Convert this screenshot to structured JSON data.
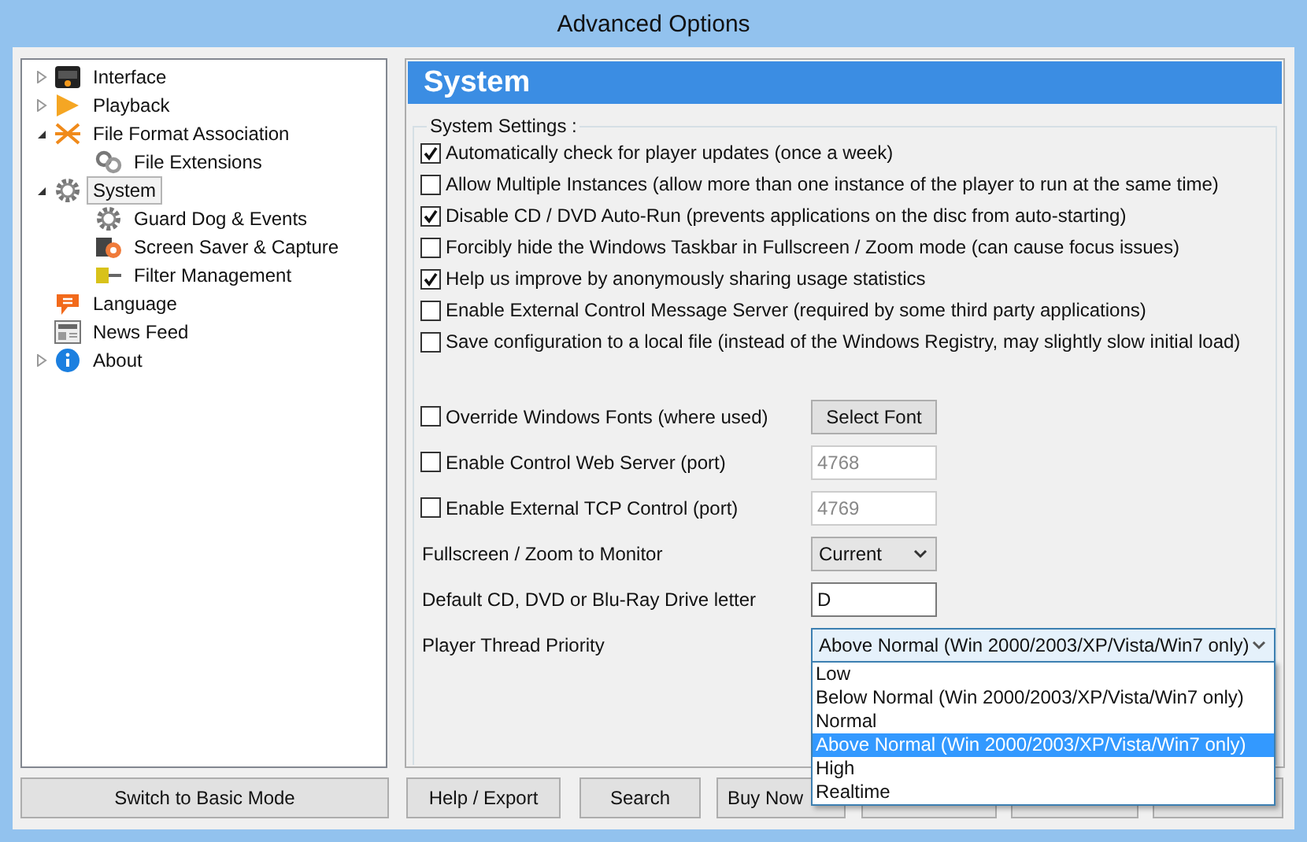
{
  "window": {
    "title": "Advanced Options"
  },
  "tree": [
    {
      "label": "Interface",
      "expanded": false,
      "selected": false
    },
    {
      "label": "Playback",
      "expanded": false,
      "selected": false
    },
    {
      "label": "File Format Association",
      "expanded": true,
      "selected": false,
      "children": [
        {
          "label": "File Extensions",
          "selected": false
        }
      ]
    },
    {
      "label": "System",
      "expanded": true,
      "selected": true,
      "children": [
        {
          "label": "Guard Dog & Events",
          "selected": false
        },
        {
          "label": "Screen Saver & Capture",
          "selected": false
        },
        {
          "label": "Filter Management",
          "selected": false
        }
      ]
    },
    {
      "label": "Language",
      "selected": false
    },
    {
      "label": "News Feed",
      "selected": false
    },
    {
      "label": "About",
      "expanded": false,
      "selected": false
    }
  ],
  "panel": {
    "title": "System",
    "legend": "System Settings :",
    "checkboxes": [
      {
        "label": "Automatically check for player updates (once a week)",
        "checked": true
      },
      {
        "label": "Allow Multiple Instances (allow more than one instance of the player to run at the same time)",
        "checked": false
      },
      {
        "label": "Disable CD / DVD Auto-Run (prevents applications on the disc from auto-starting)",
        "checked": true
      },
      {
        "label": "Forcibly hide the Windows Taskbar in Fullscreen / Zoom mode (can cause focus issues)",
        "checked": false
      },
      {
        "label": "Help us improve by anonymously sharing usage statistics",
        "checked": true
      },
      {
        "label": "Enable External Control Message Server (required by some third party applications)",
        "checked": false
      },
      {
        "label": "Save configuration to a local file (instead of the Windows Registry, may slightly slow initial load)",
        "checked": false
      }
    ],
    "options": [
      {
        "kind": "checkbox_button",
        "label": "Override Windows Fonts (where used)",
        "checked": false,
        "button": "Select Font"
      },
      {
        "kind": "checkbox_field",
        "label": "Enable Control Web Server (port)",
        "checked": false,
        "value": "4768",
        "disabled": true
      },
      {
        "kind": "checkbox_field",
        "label": "Enable External TCP Control (port)",
        "checked": false,
        "value": "4769",
        "disabled": true
      },
      {
        "kind": "select",
        "label": "Fullscreen / Zoom to Monitor",
        "value": "Current"
      },
      {
        "kind": "field",
        "label": "Default CD, DVD or Blu-Ray Drive letter",
        "value": "D"
      },
      {
        "kind": "dropdown",
        "label": "Player Thread Priority",
        "value": "Above Normal (Win 2000/2003/XP/Vista/Win7 only)",
        "expanded": true,
        "items": [
          {
            "label": "Low",
            "selected": false
          },
          {
            "label": "Below Normal (Win 2000/2003/XP/Vista/Win7 only)",
            "selected": false
          },
          {
            "label": "Normal",
            "selected": false
          },
          {
            "label": "Above Normal (Win 2000/2003/XP/Vista/Win7 only)",
            "selected": true
          },
          {
            "label": "High",
            "selected": false
          },
          {
            "label": "Realtime",
            "selected": false
          }
        ]
      }
    ]
  },
  "buttons": [
    {
      "label": "Switch to Basic Mode"
    },
    {
      "label": "Help / Export"
    },
    {
      "label": "Search"
    },
    {
      "label": "Buy Now"
    }
  ]
}
